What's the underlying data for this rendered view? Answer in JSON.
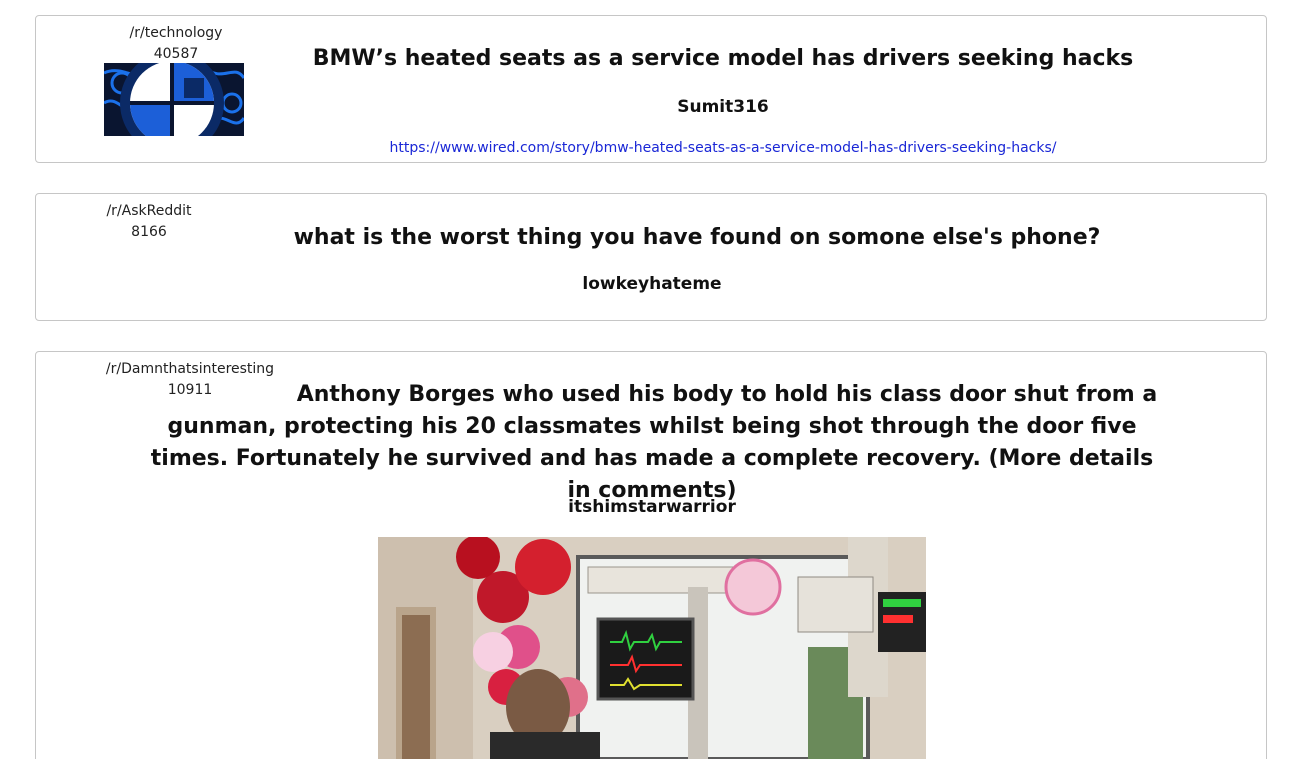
{
  "posts": [
    {
      "subreddit": "/r/technology",
      "score": "40587",
      "title": "BMW’s heated seats as a service model has drivers seeking hacks",
      "author": "Sumit316",
      "url": "https://www.wired.com/story/bmw-heated-seats-as-a-service-model-has-drivers-seeking-hacks/",
      "thumbnail": "bmw-logo-thumbnail"
    },
    {
      "subreddit": "/r/AskReddit",
      "score": "8166",
      "title": "what is the worst thing you have found on somone else's phone?",
      "author": "lowkeyhateme"
    },
    {
      "subreddit": "/r/Damnthatsinteresting",
      "score": "10911",
      "title": "Anthony Borges who used his body to hold his class door shut from a gunman, protecting his 20 classmates whilst being shot through the door five times. Fortunately he survived and has made a complete recovery. (More details in comments)",
      "author": "itshimstarwarrior",
      "image": "hospital-room-photo"
    }
  ]
}
